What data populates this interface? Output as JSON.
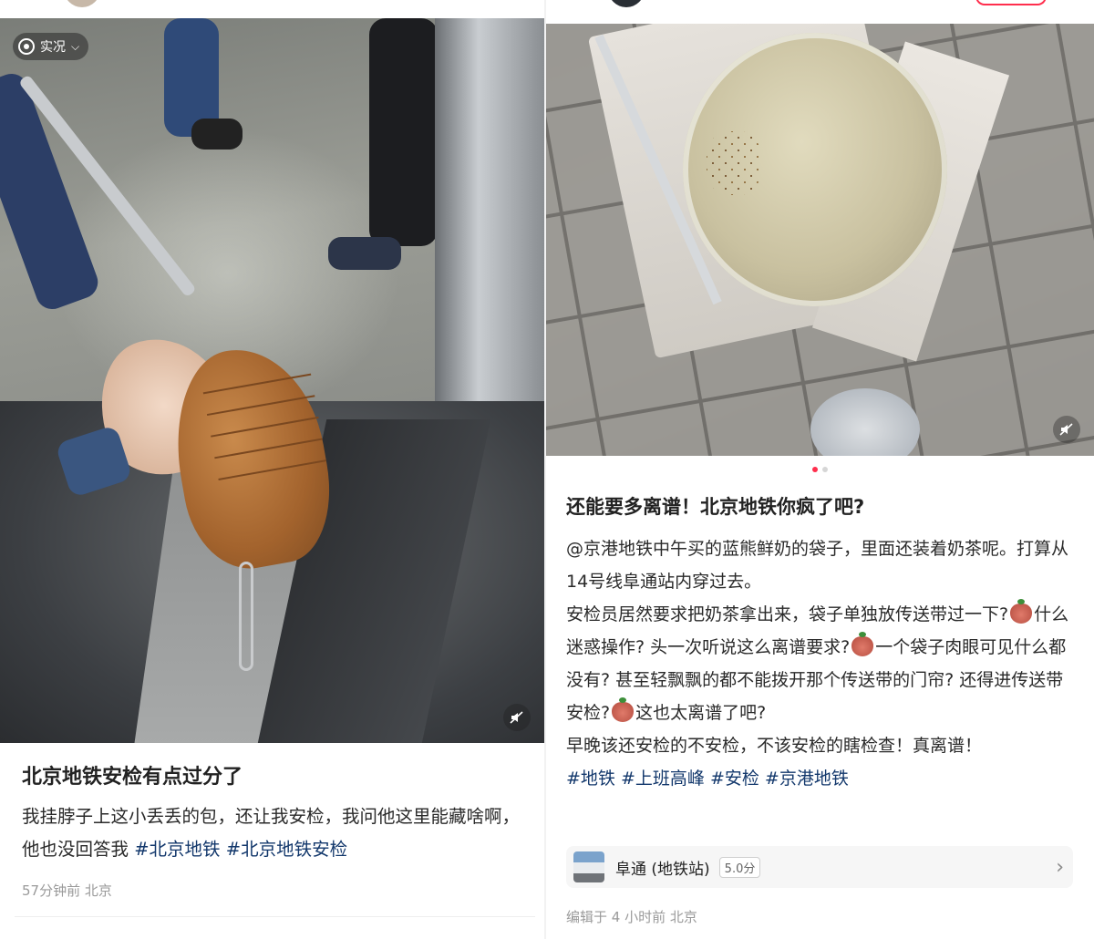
{
  "left_post": {
    "live_badge": "实况",
    "title": "北京地铁安检有点过分了",
    "body": "我挂脖子上这小丢丢的包，还让我安检，我问他这里能藏啥啊，他也没回答我 ",
    "tags": [
      "#北京地铁",
      "#北京地铁安检"
    ],
    "meta": "57分钟前 北京"
  },
  "right_post": {
    "title": "还能要多离谱！北京地铁你疯了吧?",
    "para1": "@京港地铁中午买的蓝熊鲜奶的袋子，里面还装着奶茶呢。打算从14号线阜通站内穿过去。",
    "para2_a": "安检员居然要求把奶茶拿出来，袋子单独放传送带过一下?",
    "para2_b": "什么迷惑操作? 头一次听说这么离谱要求?",
    "para2_c": "一个袋子肉眼可见什么都没有? 甚至轻飘飘的都不能拨开那个传送带的门帘? 还得进传送带安检?",
    "para2_d": "这也太离谱了吧?",
    "para3": "早晚该还安检的不安检，不该安检的瞎检查！真离谱！",
    "tags": [
      "#地铁",
      "#上班高峰",
      "#安检",
      "#京港地铁"
    ],
    "location_name": "阜通 (地铁站)",
    "location_score": "5.0分",
    "meta": "编辑于 4 小时前 北京",
    "carousel_pages": 2,
    "carousel_active": 1
  },
  "colors": {
    "accent": "#ff2e4d",
    "tag": "#13386c",
    "meta": "#9a9a9a"
  },
  "icons": {
    "live": "live-photo-icon",
    "mute": "speaker-mute-icon",
    "chevron": "chevron-right-icon",
    "emoji": "angry-face-emoji"
  }
}
